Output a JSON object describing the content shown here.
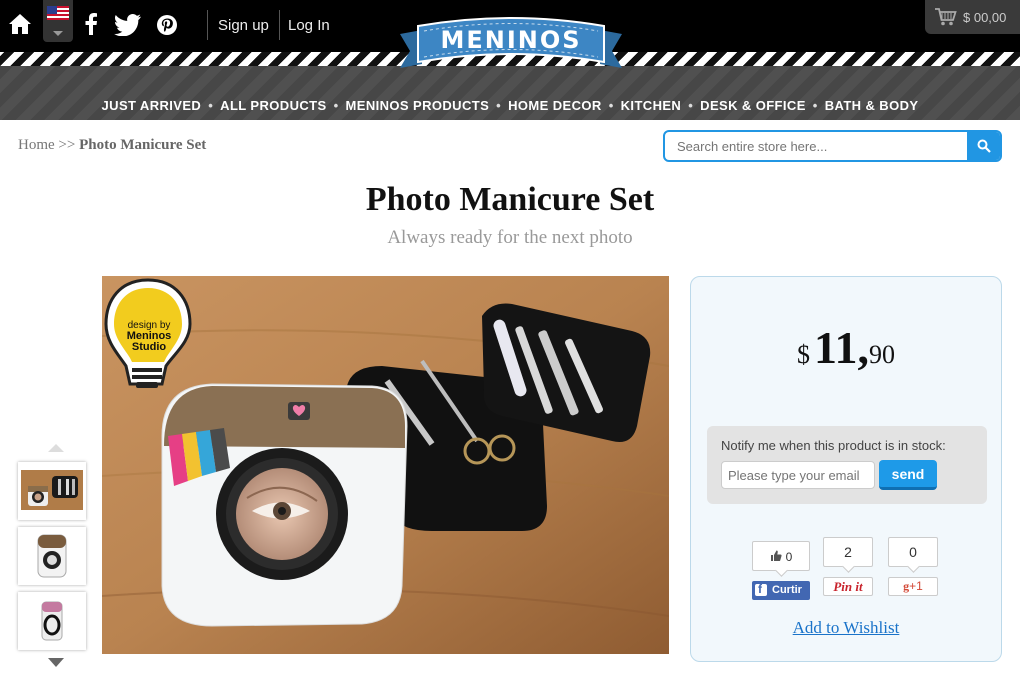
{
  "header": {
    "flag_icon": "us-flag-icon",
    "social_icons": [
      "home-icon",
      "facebook-icon",
      "twitter-icon",
      "pinterest-icon"
    ],
    "signup_label": "Sign up",
    "login_label": "Log In",
    "cart_total": "$ 00,00",
    "logo_text": "MENINOS"
  },
  "menu": {
    "items": [
      "JUST ARRIVED",
      "ALL PRODUCTS",
      "MENINOS PRODUCTS",
      "HOME DECOR",
      "KITCHEN",
      "DESK & OFFICE",
      "BATH & BODY"
    ]
  },
  "breadcrumb": {
    "home": "Home",
    "separator": ">>",
    "current": "Photo Manicure Set"
  },
  "search": {
    "placeholder": "Search entire store here..."
  },
  "product": {
    "title": "Photo Manicure Set",
    "subtitle": "Always ready for the next photo",
    "badge_text": [
      "design by",
      "Meninos",
      "Studio"
    ]
  },
  "pricebox": {
    "currency": "$",
    "price_int": "11,",
    "price_dec": "90",
    "notify_label": "Notify me when this product is in stock:",
    "notify_placeholder": "Please type your email",
    "send_label": "send",
    "fb_count": "0",
    "fb_label": "Curtir",
    "pin_count": "2",
    "pin_label": "Pin it",
    "gplus_count": "0",
    "gplus_label": "+1",
    "wishlist_label": "Add to Wishlist"
  },
  "colors": {
    "accent": "#2196e3",
    "topbar": "#000000",
    "nav": "#4d4d4d",
    "ribbon": "#3d7fb8"
  }
}
